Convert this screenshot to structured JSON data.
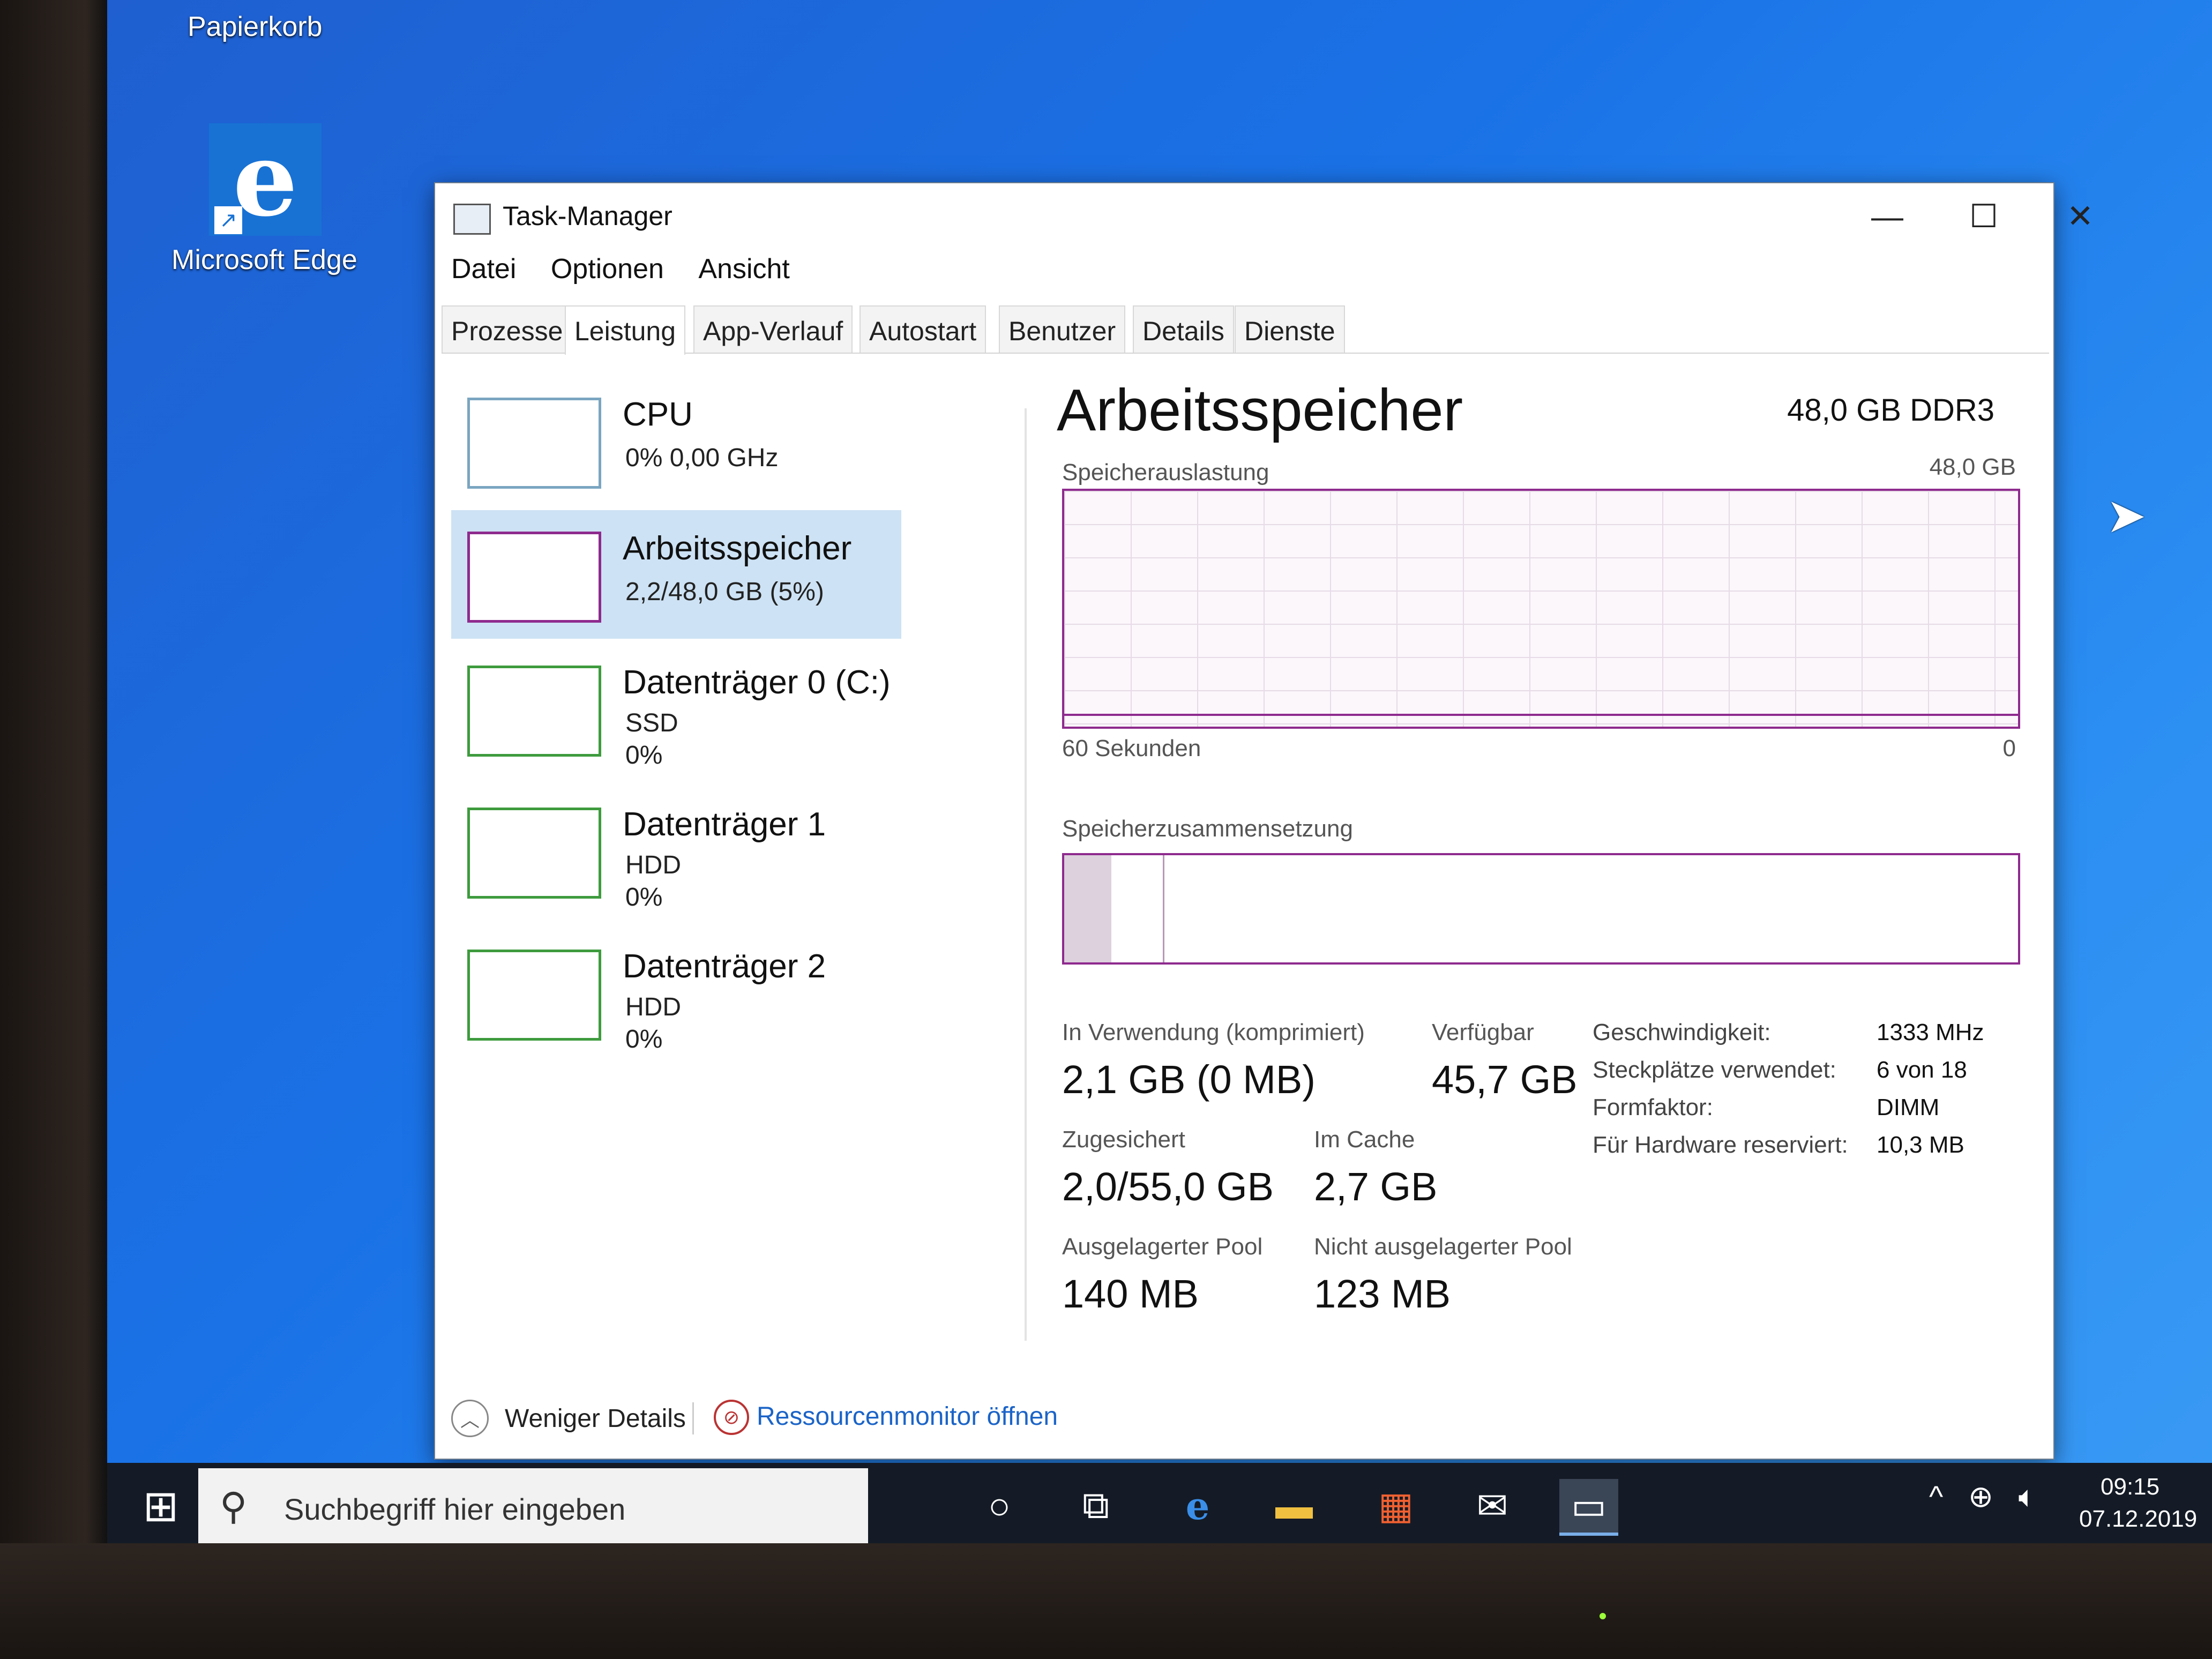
{
  "desktop": {
    "recycle_bin_label": "Papierkorb",
    "edge_label": "Microsoft Edge"
  },
  "window": {
    "title": "Task-Manager",
    "menu": [
      "Datei",
      "Optionen",
      "Ansicht"
    ],
    "tabs": [
      "Prozesse",
      "Leistung",
      "App-Verlauf",
      "Autostart",
      "Benutzer",
      "Details",
      "Dienste"
    ],
    "active_tab": "Leistung"
  },
  "resources": [
    {
      "name": "CPU",
      "line1": "0% 0,00 GHz",
      "line2": ""
    },
    {
      "name": "Arbeitsspeicher",
      "line1": "2,2/48,0 GB (5%)",
      "line2": ""
    },
    {
      "name": "Datenträger 0 (C:)",
      "line1": "SSD",
      "line2": "0%"
    },
    {
      "name": "Datenträger 1",
      "line1": "HDD",
      "line2": "0%"
    },
    {
      "name": "Datenträger 2",
      "line1": "HDD",
      "line2": "0%"
    }
  ],
  "memory": {
    "title": "Arbeitsspeicher",
    "type": "48,0 GB DDR3",
    "usage_label": "Speicherauslastung",
    "usage_max": "48,0 GB",
    "time_label": "60 Sekunden",
    "zero_label": "0",
    "composition_label": "Speicherzusammensetzung",
    "in_use_label": "In Verwendung (komprimiert)",
    "in_use_value": "2,1 GB (0 MB)",
    "available_label": "Verfügbar",
    "available_value": "45,7 GB",
    "committed_label": "Zugesichert",
    "committed_value": "2,0/55,0 GB",
    "cached_label": "Im Cache",
    "cached_value": "2,7 GB",
    "paged_label": "Ausgelagerter Pool",
    "paged_value": "140 MB",
    "nonpaged_label": "Nicht ausgelagerter Pool",
    "nonpaged_value": "123 MB",
    "speed_label": "Geschwindigkeit:",
    "speed_value": "1333 MHz",
    "slots_label": "Steckplätze verwendet:",
    "slots_value": "6 von 18",
    "form_label": "Formfaktor:",
    "form_value": "DIMM",
    "reserved_label": "Für Hardware reserviert:",
    "reserved_value": "10,3 MB"
  },
  "footer": {
    "fewer_details": "Weniger Details",
    "resource_monitor": "Ressourcenmonitor öffnen"
  },
  "taskbar": {
    "search_placeholder": "Suchbegriff hier eingeben",
    "time": "09:15",
    "date": "07.12.2019"
  },
  "colors": {
    "memory_accent": "#8e2a8e",
    "disk_accent": "#3d9b3d",
    "cpu_accent": "#7aa5c0",
    "selected_bg": "#cde2f4",
    "link": "#1b64c8"
  }
}
